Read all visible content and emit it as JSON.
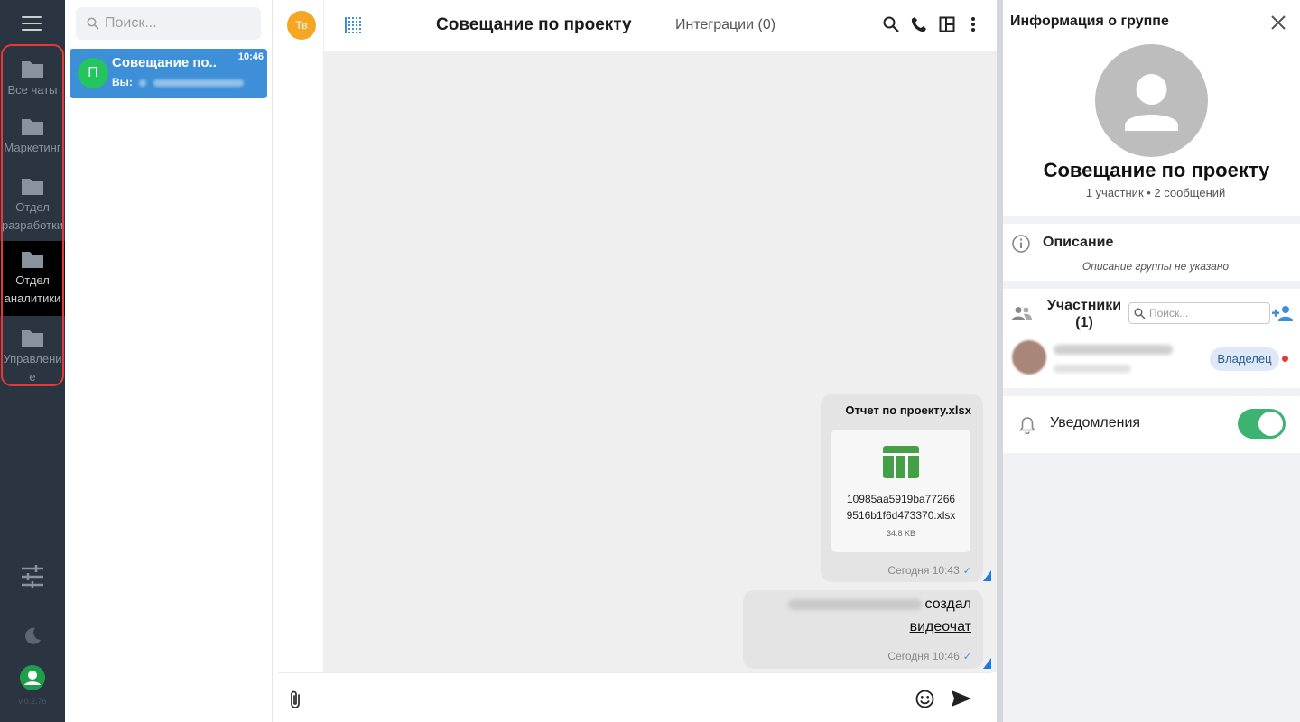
{
  "rail": {
    "folders": [
      {
        "label": "Все чаты",
        "active": false
      },
      {
        "label": "Маркетинг",
        "active": false
      },
      {
        "label": "Отдел разработки",
        "active": false
      },
      {
        "label": "Отдел аналитики",
        "active": true
      },
      {
        "label": "Управление",
        "active": false
      }
    ],
    "version": "v.0.2.76",
    "colors": {
      "background": "#2b3541",
      "active": "#000000",
      "annotation": "#e53935"
    }
  },
  "chatlist": {
    "search_placeholder": "Поиск...",
    "items": [
      {
        "avatar_letter": "П",
        "title": "Совещание по..",
        "time": "10:46",
        "preview_prefix": "Вы:",
        "selected": true
      }
    ]
  },
  "chat": {
    "sender_avatar": "Тв",
    "title": "Совещание по проекту",
    "integrations": "Интеграции (0)",
    "messages": [
      {
        "type": "file",
        "file_title": "Отчет по проекту.xlsx",
        "file_id": "10985aa5919ba77266 9516b1f6d473370.xlsx",
        "file_id_line1": "10985aa5919ba77266",
        "file_id_line2": "9516b1f6d473370.xlsx",
        "size": "34.8 KB",
        "time": "Сегодня 10:43"
      },
      {
        "type": "system",
        "text": "создал",
        "link": "видеочат",
        "time": "Сегодня 10:46"
      }
    ]
  },
  "info": {
    "title": "Информация о группе",
    "group_name": "Совещание по проекту",
    "meta": "1 участник • 2 сообщений",
    "description_title": "Описание",
    "description_text": "Описание группы не указано",
    "members_title": "Участники (1)",
    "members_search_placeholder": "Поиск...",
    "member_role": "Владелец",
    "notifications_label": "Уведомления",
    "notifications_on": true
  }
}
